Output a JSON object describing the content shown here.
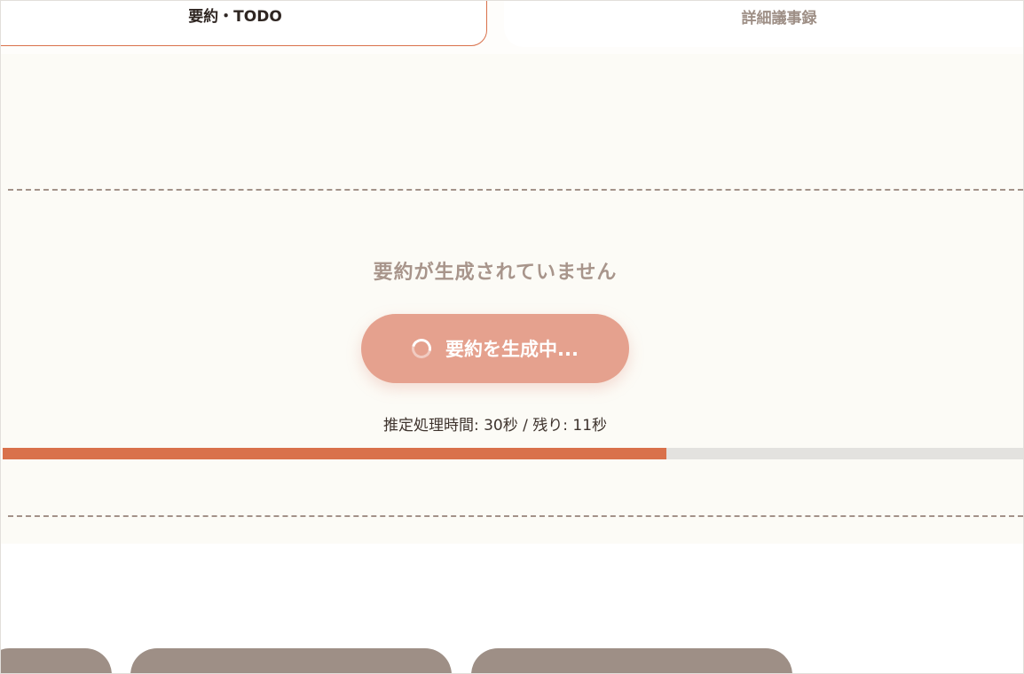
{
  "tabs": {
    "summary_label": "要約・TODO",
    "minutes_label": "詳細議事録"
  },
  "panel": {
    "empty_message": "要約が生成されていません",
    "generate_button_label": "要約を生成中...",
    "time_info": "推定処理時間: 30秒 / 残り: 11秒",
    "progress_percent": 65
  },
  "colors": {
    "accent": "#d9714b",
    "button": "#e5a18e",
    "muted": "#9e8f86"
  }
}
